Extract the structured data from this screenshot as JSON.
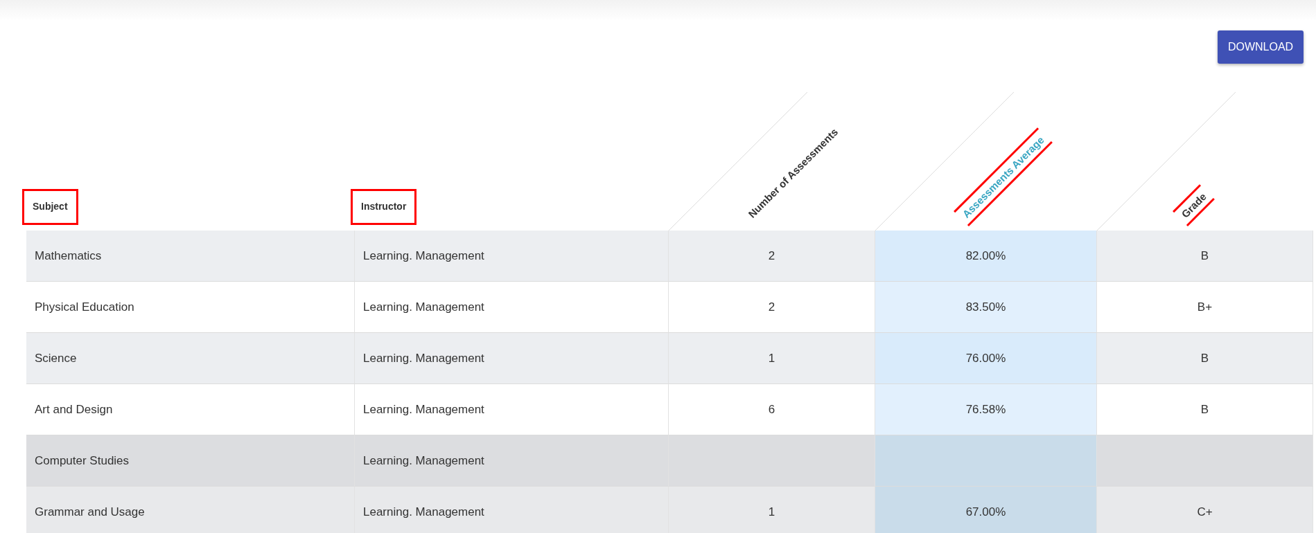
{
  "download_button": {
    "label": "DOWNLOAD"
  },
  "table": {
    "columns": [
      {
        "label": "Subject",
        "kind": "plain",
        "highlighted": true,
        "selected": false
      },
      {
        "label": "Instructor",
        "kind": "plain",
        "highlighted": true,
        "selected": false
      },
      {
        "label": "Number of Assessments",
        "kind": "rotated",
        "highlighted": false,
        "selected": false
      },
      {
        "label": "Assessments Average",
        "kind": "rotated",
        "highlighted": true,
        "selected": true
      },
      {
        "label": "Grade",
        "kind": "rotated",
        "highlighted": true,
        "selected": false
      }
    ],
    "rows": [
      [
        "Mathematics",
        "Learning. Management",
        "2",
        "82.00%",
        "B"
      ],
      [
        "Physical Education",
        "Learning. Management",
        "2",
        "83.50%",
        "B+"
      ],
      [
        "Science",
        "Learning. Management",
        "1",
        "76.00%",
        "B"
      ],
      [
        "Art and Design",
        "Learning. Management",
        "6",
        "76.58%",
        "B"
      ],
      [
        "Computer Studies",
        "Learning. Management",
        null,
        null,
        null
      ],
      [
        "Grammar and Usage",
        "Learning. Management",
        "1",
        "67.00%",
        "C+"
      ]
    ]
  }
}
